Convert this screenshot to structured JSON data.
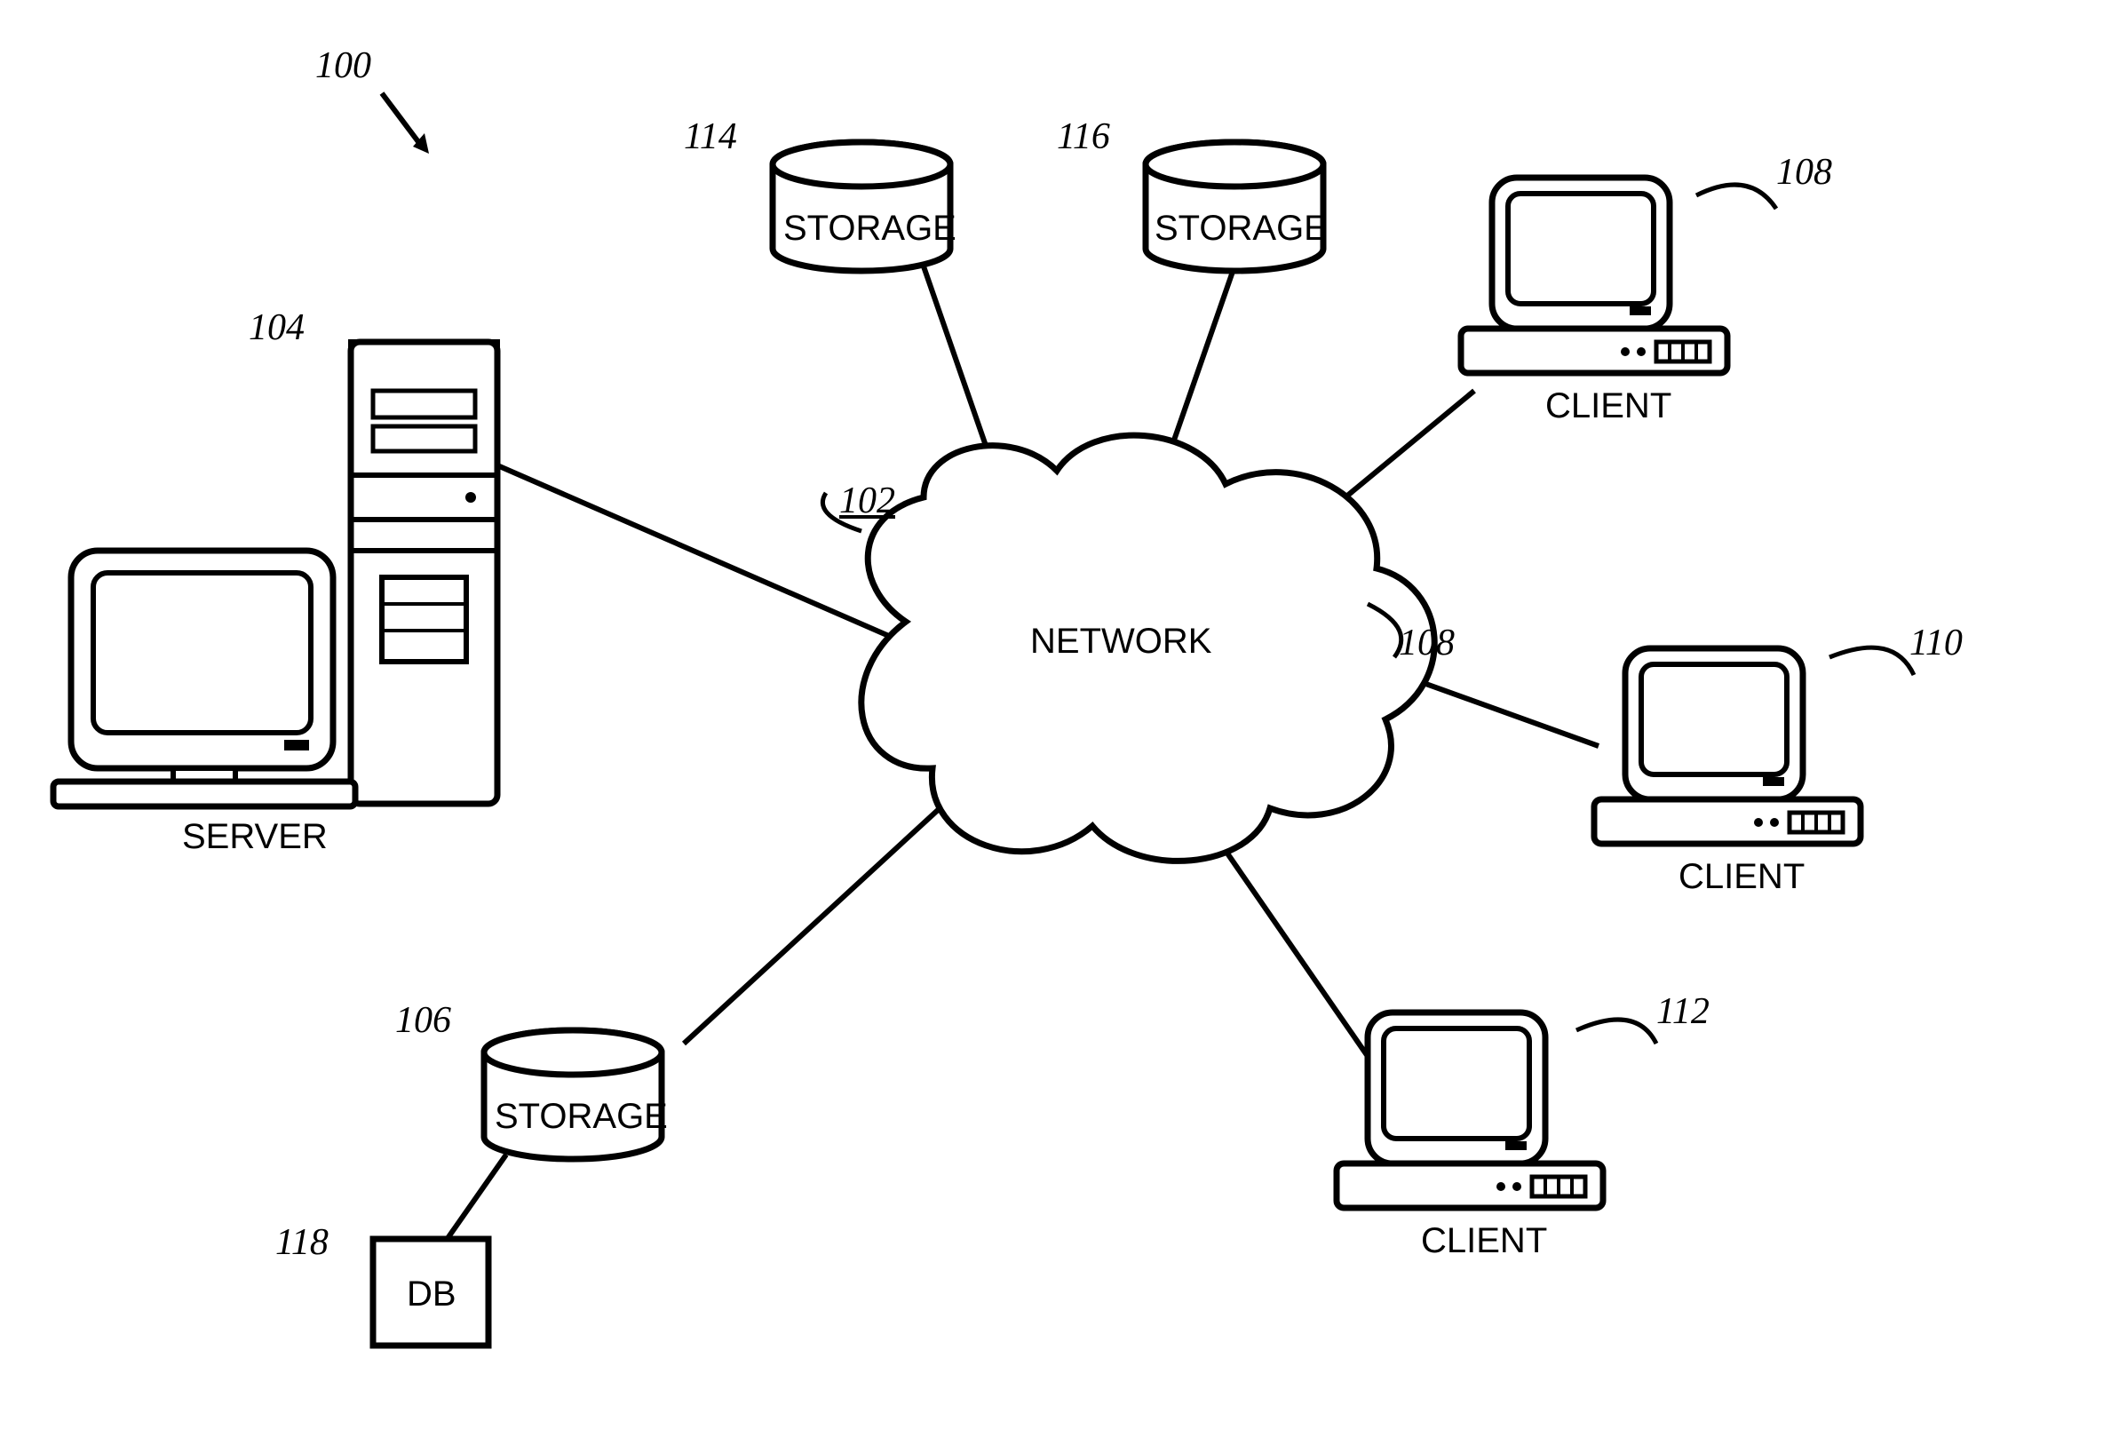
{
  "figure_ref": "100",
  "network": {
    "label": "NETWORK",
    "ref": "102",
    "edge_ref": "108"
  },
  "server": {
    "label": "SERVER",
    "ref": "104"
  },
  "storage_top_left": {
    "label": "STORAGE",
    "ref": "114"
  },
  "storage_top_right": {
    "label": "STORAGE",
    "ref": "116"
  },
  "storage_bottom": {
    "label": "STORAGE",
    "ref": "106"
  },
  "db": {
    "label": "DB",
    "ref": "118"
  },
  "client_top": {
    "label": "CLIENT",
    "ref": "108"
  },
  "client_mid": {
    "label": "CLIENT",
    "ref": "110"
  },
  "client_bottom": {
    "label": "CLIENT",
    "ref": "112"
  }
}
